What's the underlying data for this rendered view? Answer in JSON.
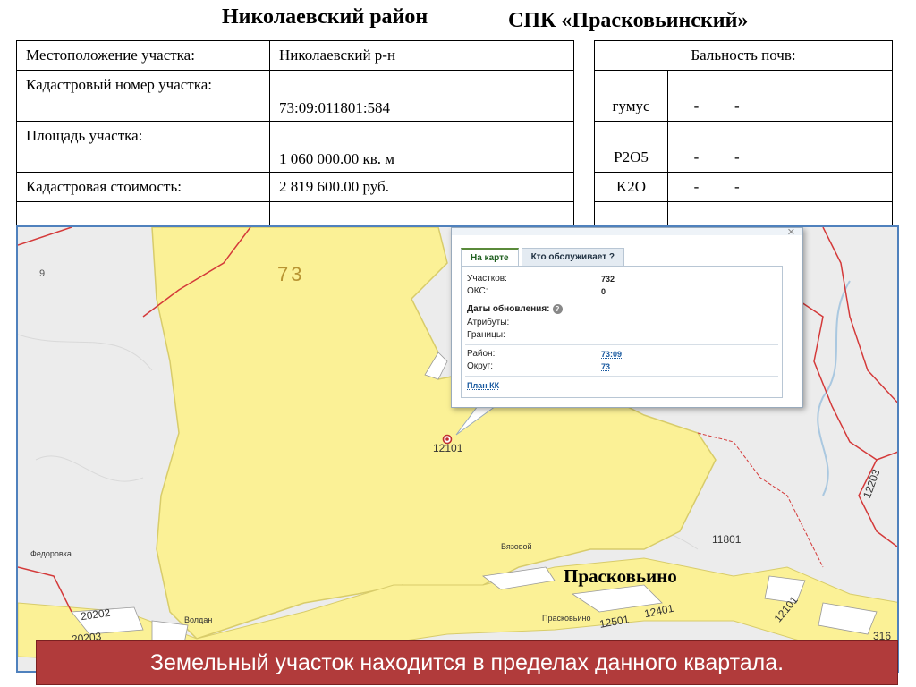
{
  "header": {
    "district": "Николаевский район",
    "organization": "СПК «Прасковьинский»"
  },
  "parcel_table": [
    {
      "label": "Местоположение участка:",
      "value": "Николаевский р-н"
    },
    {
      "label": "Кадастровый номер участка:",
      "value": "73:09:011801:584"
    },
    {
      "label": "Площадь участка:",
      "value": "1 060 000.00 кв. м"
    },
    {
      "label": "Кадастровая стоимость:",
      "value": "2 819 600.00 руб."
    }
  ],
  "soil_table": {
    "header": "Бальность почв:",
    "rows": [
      {
        "name": "гумус",
        "a": "-",
        "b": "-"
      },
      {
        "name": "P2O5",
        "a": "-",
        "b": "-"
      },
      {
        "name": "K2O",
        "a": "-",
        "b": "-"
      }
    ]
  },
  "map": {
    "colors": {
      "zone": "#fbf196",
      "zone_border": "#d8cc6a",
      "boundary": "#d43a3a",
      "background": "#ececec"
    },
    "labels": {
      "region_code": "73",
      "side_number": "9",
      "block_main": "12101",
      "block_1": "11801",
      "block_2": "12203",
      "block_3": "12401",
      "block_4": "12501",
      "block_5": "20202",
      "block_6": "20203",
      "block_7": "12101",
      "corner": "316",
      "town": "Прасковьино",
      "village_1": "Федоровка",
      "village_2": "Вязовой",
      "village_3": "Волдан",
      "village_4": "Прасковьино"
    },
    "popup": {
      "tabs": [
        "На карте",
        "Кто обслуживает ?"
      ],
      "rows": {
        "parcels_label": "Участков:",
        "parcels_value": "732",
        "oks_label": "ОКС:",
        "oks_value": "0",
        "updates_label": "Даты обновления:",
        "attributes_label": "Атрибуты:",
        "borders_label": "Границы:",
        "district_label": "Район:",
        "district_value": "73:09",
        "okrug_label": "Округ:",
        "okrug_value": "73",
        "plan_link": "План КК"
      },
      "close_icon": "close-icon",
      "help_icon": "question-icon"
    },
    "marker_icon": "location-pin-icon"
  },
  "caption": "Земельный участок находится в пределах данного квартала."
}
